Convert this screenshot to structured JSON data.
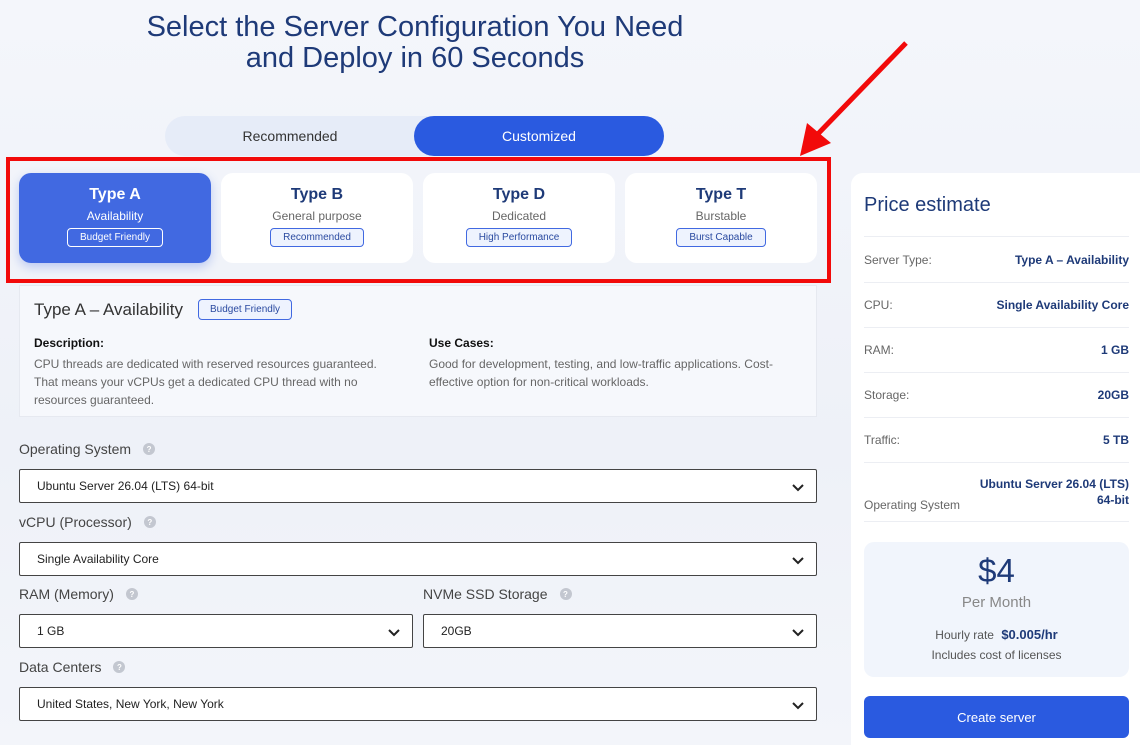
{
  "hero": {
    "title_line1": "Select the Server Configuration You Need",
    "title_line2": "and Deploy in 60 Seconds"
  },
  "toggle": {
    "recommended": "Recommended",
    "customized": "Customized",
    "selected": "Customized"
  },
  "types": [
    {
      "name": "Type A",
      "subtitle": "Availability",
      "badge": "Budget Friendly",
      "active": true
    },
    {
      "name": "Type B",
      "subtitle": "General purpose",
      "badge": "Recommended",
      "active": false
    },
    {
      "name": "Type D",
      "subtitle": "Dedicated",
      "badge": "High Performance",
      "active": false
    },
    {
      "name": "Type T",
      "subtitle": "Burstable",
      "badge": "Burst Capable",
      "active": false
    }
  ],
  "details": {
    "title": "Type A – Availability",
    "badge": "Budget Friendly",
    "description_label": "Description:",
    "description_text": "CPU threads are dedicated with reserved resources guaranteed. That means your vCPUs get a dedicated CPU thread with no resources guaranteed.",
    "use_cases_label": "Use Cases:",
    "use_cases_text": "Good for development, testing, and low-traffic applications. Cost-effective option for non-critical workloads."
  },
  "form": {
    "os": {
      "label": "Operating System",
      "value": "Ubuntu Server 26.04 (LTS) 64-bit"
    },
    "vcpu": {
      "label": "vCPU (Processor)",
      "value": "Single Availability Core"
    },
    "ram": {
      "label": "RAM (Memory)",
      "value": "1 GB"
    },
    "storage": {
      "label": "NVMe SSD Storage",
      "value": "20GB"
    },
    "datacenter": {
      "label": "Data Centers",
      "value": "United States, New York, New York"
    },
    "help_glyph": "?"
  },
  "price": {
    "title": "Price estimate",
    "rows": [
      {
        "label": "Server Type:",
        "value": "Type A – Availability"
      },
      {
        "label": "CPU:",
        "value": "Single Availability Core"
      },
      {
        "label": "RAM:",
        "value": "1 GB"
      },
      {
        "label": "Storage:",
        "value": "20GB"
      },
      {
        "label": "Traffic:",
        "value": "5 TB"
      },
      {
        "label": "Operating System",
        "value": "Ubuntu Server 26.04 (LTS) 64-bit"
      }
    ],
    "amount": "$4",
    "period": "Per Month",
    "hourly_label": "Hourly rate",
    "hourly_value": "$0.005/hr",
    "licenses_note": "Includes cost of licenses",
    "button_label": "Create server"
  },
  "colors": {
    "accent": "#2a5ae0",
    "active_card": "#4169e1",
    "heading": "#1e3a78",
    "highlight_box": "#f20a0a"
  },
  "icons": {
    "dropdown": "chevron-down-icon",
    "help": "help-icon",
    "annotation": "red-arrow-icon"
  }
}
